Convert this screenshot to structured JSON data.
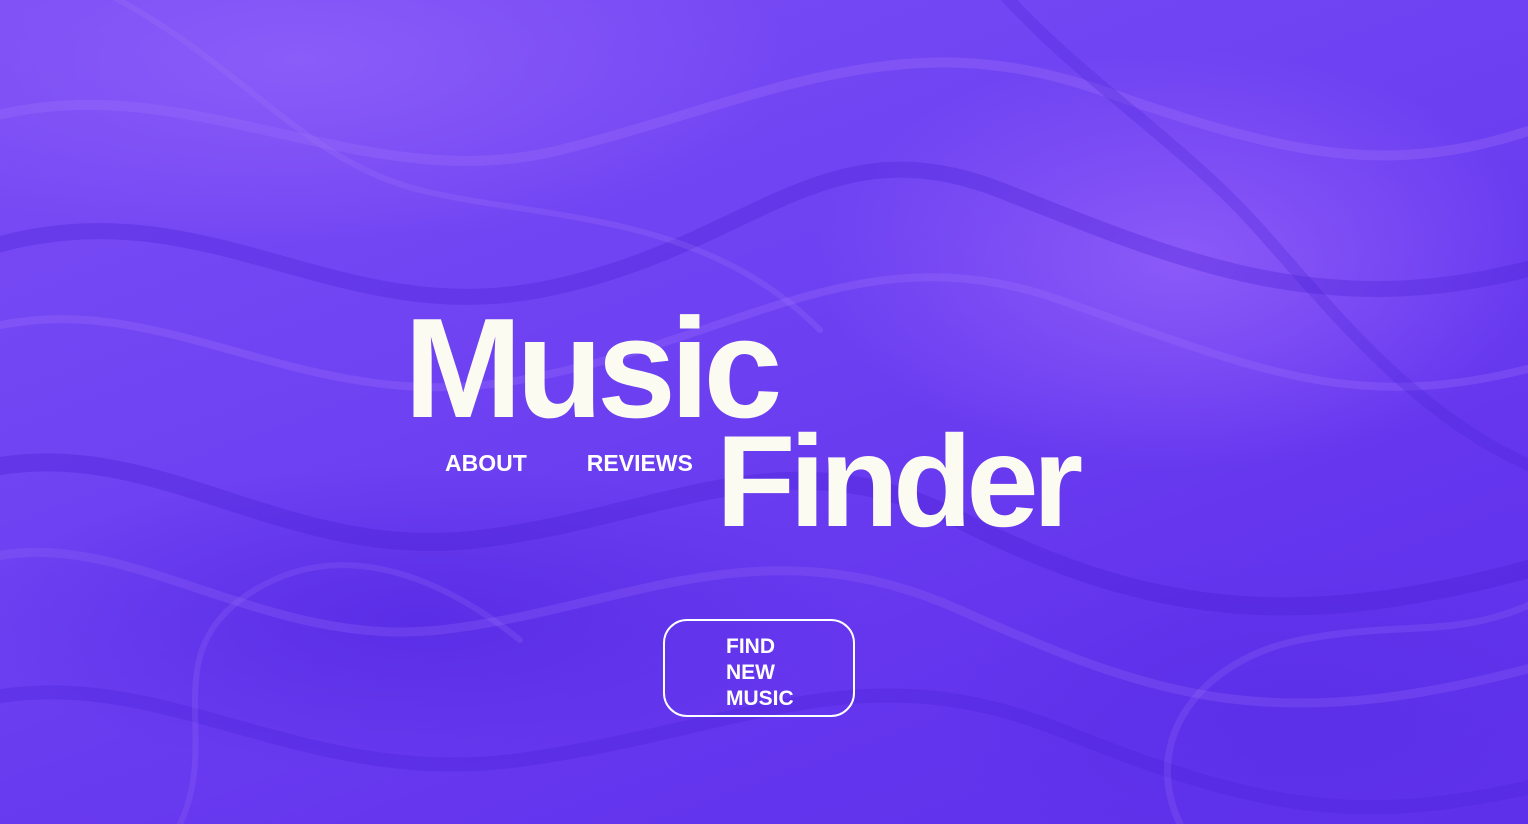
{
  "brand": {
    "line1": "Music",
    "line2": "Finder"
  },
  "nav": {
    "about": "ABOUT",
    "reviews": "REVIEWS"
  },
  "cta": {
    "line1": "FIND",
    "line2": "NEW",
    "line3": "MUSIC"
  },
  "colors": {
    "background": "#6a3cf0",
    "text": "#ffffff",
    "logo": "#fbfbf2"
  }
}
